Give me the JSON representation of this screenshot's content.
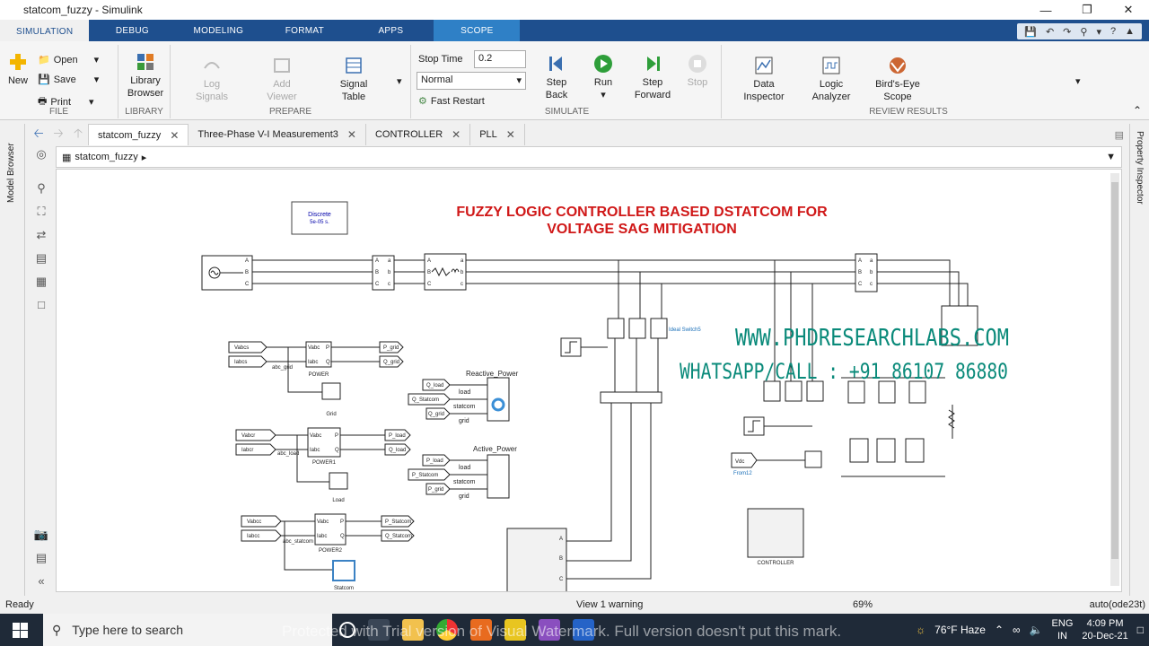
{
  "window": {
    "title": "statcom_fuzzy - Simulink"
  },
  "ribbon_tabs": [
    "SIMULATION",
    "DEBUG",
    "MODELING",
    "FORMAT",
    "APPS",
    "SCOPE"
  ],
  "file": {
    "new": "New",
    "open": "Open",
    "save": "Save",
    "print": "Print",
    "label": "FILE"
  },
  "library": {
    "browser": "Library Browser",
    "label": "LIBRARY"
  },
  "prepare": {
    "log": "Log Signals",
    "add": "Add Viewer",
    "table": "Signal Table",
    "label": "PREPARE"
  },
  "simulate": {
    "stop_time_label": "Stop Time",
    "stop_time": "0.2",
    "mode": "Normal",
    "fast": "Fast Restart",
    "step_back": "Step Back",
    "run": "Run",
    "step_fwd": "Step Forward",
    "stop": "Stop",
    "label": "SIMULATE"
  },
  "review": {
    "data": "Data Inspector",
    "logic": "Logic Analyzer",
    "birds": "Bird's-Eye Scope",
    "label": "REVIEW RESULTS"
  },
  "doc_tabs": [
    "statcom_fuzzy",
    "Three-Phase V-I Measurement3",
    "CONTROLLER",
    "PLL"
  ],
  "breadcrumb": "statcom_fuzzy",
  "side": {
    "left": "Model Browser",
    "right": "Property Inspector"
  },
  "model": {
    "title1": "FUZZY LOGIC CONTROLLER BASED DSTATCOM FOR",
    "title2": "VOLTAGE SAG MITIGATION",
    "discrete1": "Discrete",
    "discrete2": "5e-05 s.",
    "ideal": "Ideal Switch5",
    "wm1": "WWW.PHDRESEARCHLABS.COM",
    "wm2": "WHATSAPP/CALL : +91 86107 86880",
    "reactive": "Reactive_Power",
    "active": "Active_Power",
    "power": "POWER",
    "power1": "POWER1",
    "power2": "POWER2",
    "grid": "Grid",
    "load": "Load",
    "statcom": "Statcom",
    "controller": "CONTROLLER",
    "vdc": "Vdc",
    "from12": "From12",
    "vabcs": "Vabcs",
    "iabcs": "Iabcs",
    "vabcr": "Vabcr",
    "iabcr": "Iabcr",
    "vabcc": "Vabcc",
    "iabcc": "Iabcc",
    "pgrid": "P_grid",
    "qgrid": "Q_grid",
    "pload": "P_load",
    "qload": "Q_load",
    "pstat": "P_Statcom",
    "qstat": "Q_Statcom",
    "vabc": "Vabc",
    "iabc": "Iabc",
    "P": "P",
    "Q": "Q",
    "abcgrid": "abc_grid",
    "abcload": "abc_load",
    "abcstat": "abc_statcom",
    "loadlbl": "load",
    "statcomlbl": "statcom",
    "gridlbl": "grid",
    "A": "A",
    "B": "B",
    "C": "C",
    "a": "a",
    "b": "b",
    "c": "c"
  },
  "status": {
    "ready": "Ready",
    "warning": "View 1 warning",
    "zoom": "69%",
    "solver": "auto(ode23t)"
  },
  "taskbar": {
    "search": "Type here to search",
    "weather": "76°F Haze",
    "lang1": "ENG",
    "lang2": "IN",
    "time": "4:09 PM",
    "date": "20-Dec-21",
    "watermark": "Protected with Trial version of Visual Watermark. Full version doesn't put this mark."
  }
}
